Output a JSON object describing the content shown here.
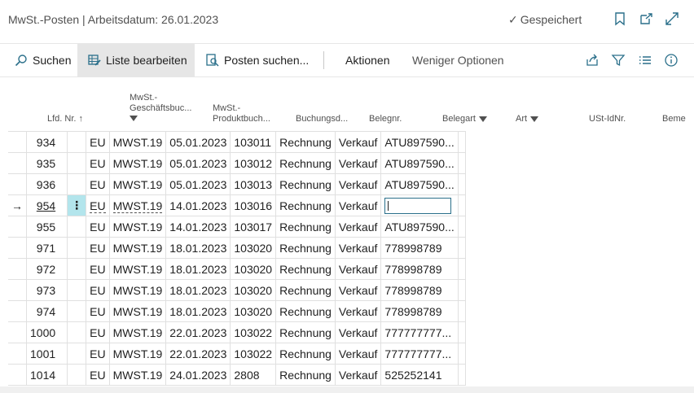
{
  "header": {
    "title": "MwSt.-Posten | Arbeitsdatum: 26.01.2023",
    "saved_label": "Gespeichert"
  },
  "toolbar": {
    "search": "Suchen",
    "edit_list": "Liste bearbeiten",
    "find_entries": "Posten suchen...",
    "actions": "Aktionen",
    "fewer_options": "Weniger Optionen"
  },
  "columns": {
    "entry_no": "Lfd. Nr.",
    "gen_bus_1": "MwSt.-",
    "gen_bus_2": "Geschäftsbuc...",
    "prod_1": "MwSt.-",
    "prod_2": "Produktbuch...",
    "posting_date": "Buchungsd...",
    "doc_no": "Belegnr.",
    "doc_type": "Belegart",
    "type": "Art",
    "vat_id": "USt-IdNr.",
    "more": "Beme"
  },
  "sort_arrow": "↑",
  "current_row_marker": "→",
  "row_menu": "⋮",
  "rows": [
    {
      "no": "934",
      "bus": "EU",
      "prod": "MWST.19",
      "date": "05.01.2023",
      "doc": "103011",
      "doctype": "Rechnung",
      "art": "Verkauf",
      "vat": "ATU897590..."
    },
    {
      "no": "935",
      "bus": "EU",
      "prod": "MWST.19",
      "date": "05.01.2023",
      "doc": "103012",
      "doctype": "Rechnung",
      "art": "Verkauf",
      "vat": "ATU897590..."
    },
    {
      "no": "936",
      "bus": "EU",
      "prod": "MWST.19",
      "date": "05.01.2023",
      "doc": "103013",
      "doctype": "Rechnung",
      "art": "Verkauf",
      "vat": "ATU897590..."
    },
    {
      "no": "954",
      "bus": "EU",
      "prod": "MWST.19",
      "date": "14.01.2023",
      "doc": "103016",
      "doctype": "Rechnung",
      "art": "Verkauf",
      "vat": ""
    },
    {
      "no": "955",
      "bus": "EU",
      "prod": "MWST.19",
      "date": "14.01.2023",
      "doc": "103017",
      "doctype": "Rechnung",
      "art": "Verkauf",
      "vat": "ATU897590..."
    },
    {
      "no": "971",
      "bus": "EU",
      "prod": "MWST.19",
      "date": "18.01.2023",
      "doc": "103020",
      "doctype": "Rechnung",
      "art": "Verkauf",
      "vat": "778998789"
    },
    {
      "no": "972",
      "bus": "EU",
      "prod": "MWST.19",
      "date": "18.01.2023",
      "doc": "103020",
      "doctype": "Rechnung",
      "art": "Verkauf",
      "vat": "778998789"
    },
    {
      "no": "973",
      "bus": "EU",
      "prod": "MWST.19",
      "date": "18.01.2023",
      "doc": "103020",
      "doctype": "Rechnung",
      "art": "Verkauf",
      "vat": "778998789"
    },
    {
      "no": "974",
      "bus": "EU",
      "prod": "MWST.19",
      "date": "18.01.2023",
      "doc": "103020",
      "doctype": "Rechnung",
      "art": "Verkauf",
      "vat": "778998789"
    },
    {
      "no": "1000",
      "bus": "EU",
      "prod": "MWST.19",
      "date": "22.01.2023",
      "doc": "103022",
      "doctype": "Rechnung",
      "art": "Verkauf",
      "vat": "777777777..."
    },
    {
      "no": "1001",
      "bus": "EU",
      "prod": "MWST.19",
      "date": "22.01.2023",
      "doc": "103022",
      "doctype": "Rechnung",
      "art": "Verkauf",
      "vat": "777777777..."
    },
    {
      "no": "1014",
      "bus": "EU",
      "prod": "MWST.19",
      "date": "24.01.2023",
      "doc": "2808",
      "doctype": "Rechnung",
      "art": "Verkauf",
      "vat": "525252141"
    }
  ],
  "current_row_index": 3,
  "colors": {
    "accent": "#2a6f8a",
    "row_menu_bg": "#b3e5ec"
  }
}
